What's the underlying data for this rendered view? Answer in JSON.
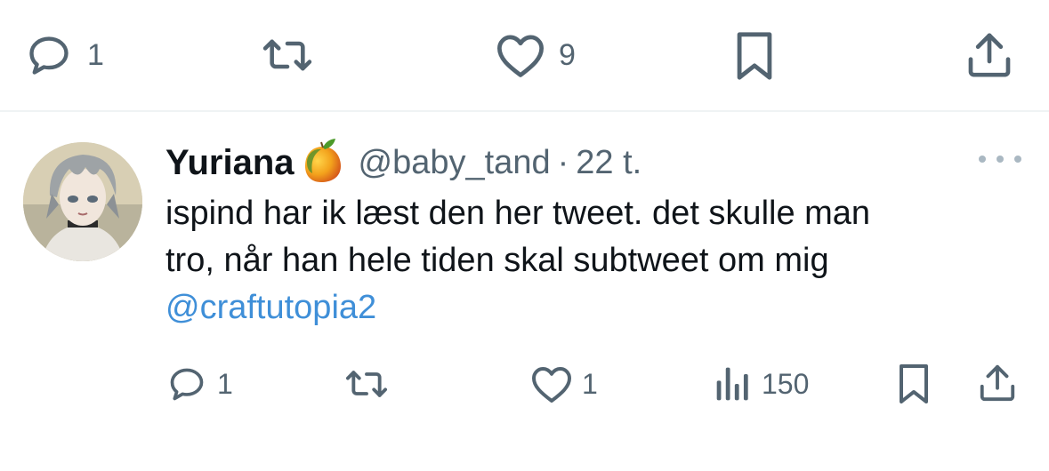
{
  "top_actions": {
    "reply_count": "1",
    "retweet_count": "",
    "like_count": "9",
    "icons": [
      "reply-icon",
      "retweet-icon",
      "heart-icon",
      "bookmark-icon",
      "share-icon"
    ]
  },
  "reply_tweet": {
    "display_name": "Yuriana",
    "badge_icon": "mango-emoji",
    "handle": "@baby_tand",
    "separator": "·",
    "time": "22 t.",
    "text_lines": [
      "ispind har ik læst den her tweet. det skulle man",
      "tro, når han hele tiden skal subtweet om mig"
    ],
    "mention": "@craftutopia2",
    "actions": {
      "reply_count": "1",
      "like_count": "1",
      "views_count": "150"
    }
  },
  "colors": {
    "icon_gray": "#536471",
    "text": "#0f1419",
    "link_blue": "#3f8fd8",
    "divider": "#eff3f4"
  }
}
